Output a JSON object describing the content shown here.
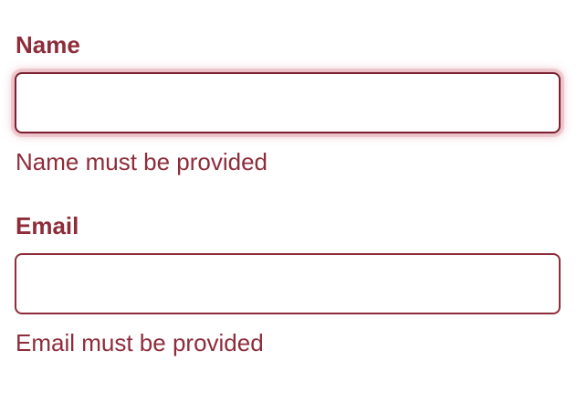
{
  "form": {
    "name": {
      "label": "Name",
      "value": "",
      "placeholder": "",
      "error": "Name must be provided"
    },
    "email": {
      "label": "Email",
      "value": "",
      "placeholder": "",
      "error": "Email must be provided"
    }
  },
  "colors": {
    "error": "#8e2c3a",
    "focus_glow": "#d67884",
    "background": "#ffffff"
  }
}
